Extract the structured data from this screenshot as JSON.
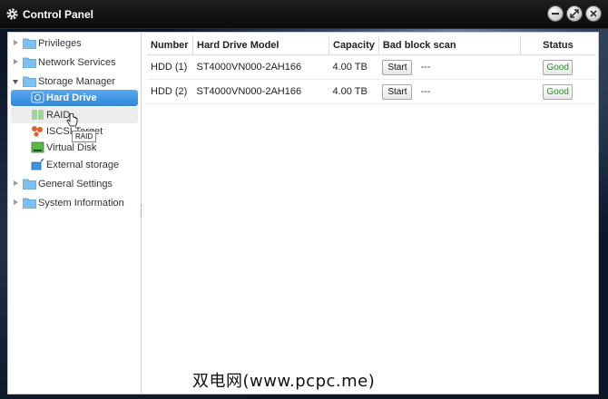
{
  "window": {
    "title": "Control Panel"
  },
  "sidebar": {
    "items": [
      {
        "label": "Privileges"
      },
      {
        "label": "Network Services"
      },
      {
        "label": "Storage Manager"
      },
      {
        "label": "Hard Drive"
      },
      {
        "label": "RAID"
      },
      {
        "label": "ISCSI Target"
      },
      {
        "label": "Virtual Disk"
      },
      {
        "label": "External storage"
      },
      {
        "label": "General Settings"
      },
      {
        "label": "System Information"
      }
    ],
    "selected": "Hard Drive",
    "tooltip": "RAID"
  },
  "table": {
    "headers": [
      "Number",
      "Hard Drive Model",
      "Capacity",
      "Bad block scan",
      "Status"
    ],
    "rows": [
      {
        "number": "HDD (1)",
        "model": "ST4000VN000-2AH166",
        "capacity": "4.00 TB",
        "scan_button": "Start",
        "scan_result": "---",
        "status": "Good"
      },
      {
        "number": "HDD (2)",
        "model": "ST4000VN000-2AH166",
        "capacity": "4.00 TB",
        "scan_button": "Start",
        "scan_result": "---",
        "status": "Good"
      }
    ]
  },
  "watermark": "双电网(www.pcpc.me)",
  "colors": {
    "selection": "#2f86d9",
    "status_good": "#2d8a2d",
    "folder": "#7ec1f0"
  }
}
